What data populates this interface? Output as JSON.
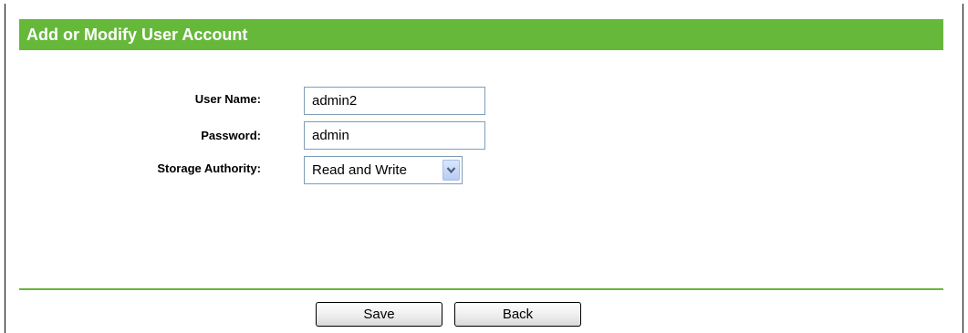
{
  "header": {
    "title": "Add or Modify User Account"
  },
  "form": {
    "username_label": "User Name:",
    "username_value": "admin2",
    "password_label": "Password:",
    "password_value": "admin",
    "storage_label": "Storage Authority:",
    "storage_value": "Read and Write",
    "storage_dropdown_icon": "chevron-down-icon"
  },
  "buttons": {
    "save_label": "Save",
    "back_label": "Back"
  },
  "colors": {
    "accent_green": "#66b83b",
    "header_text": "#ffffff"
  }
}
